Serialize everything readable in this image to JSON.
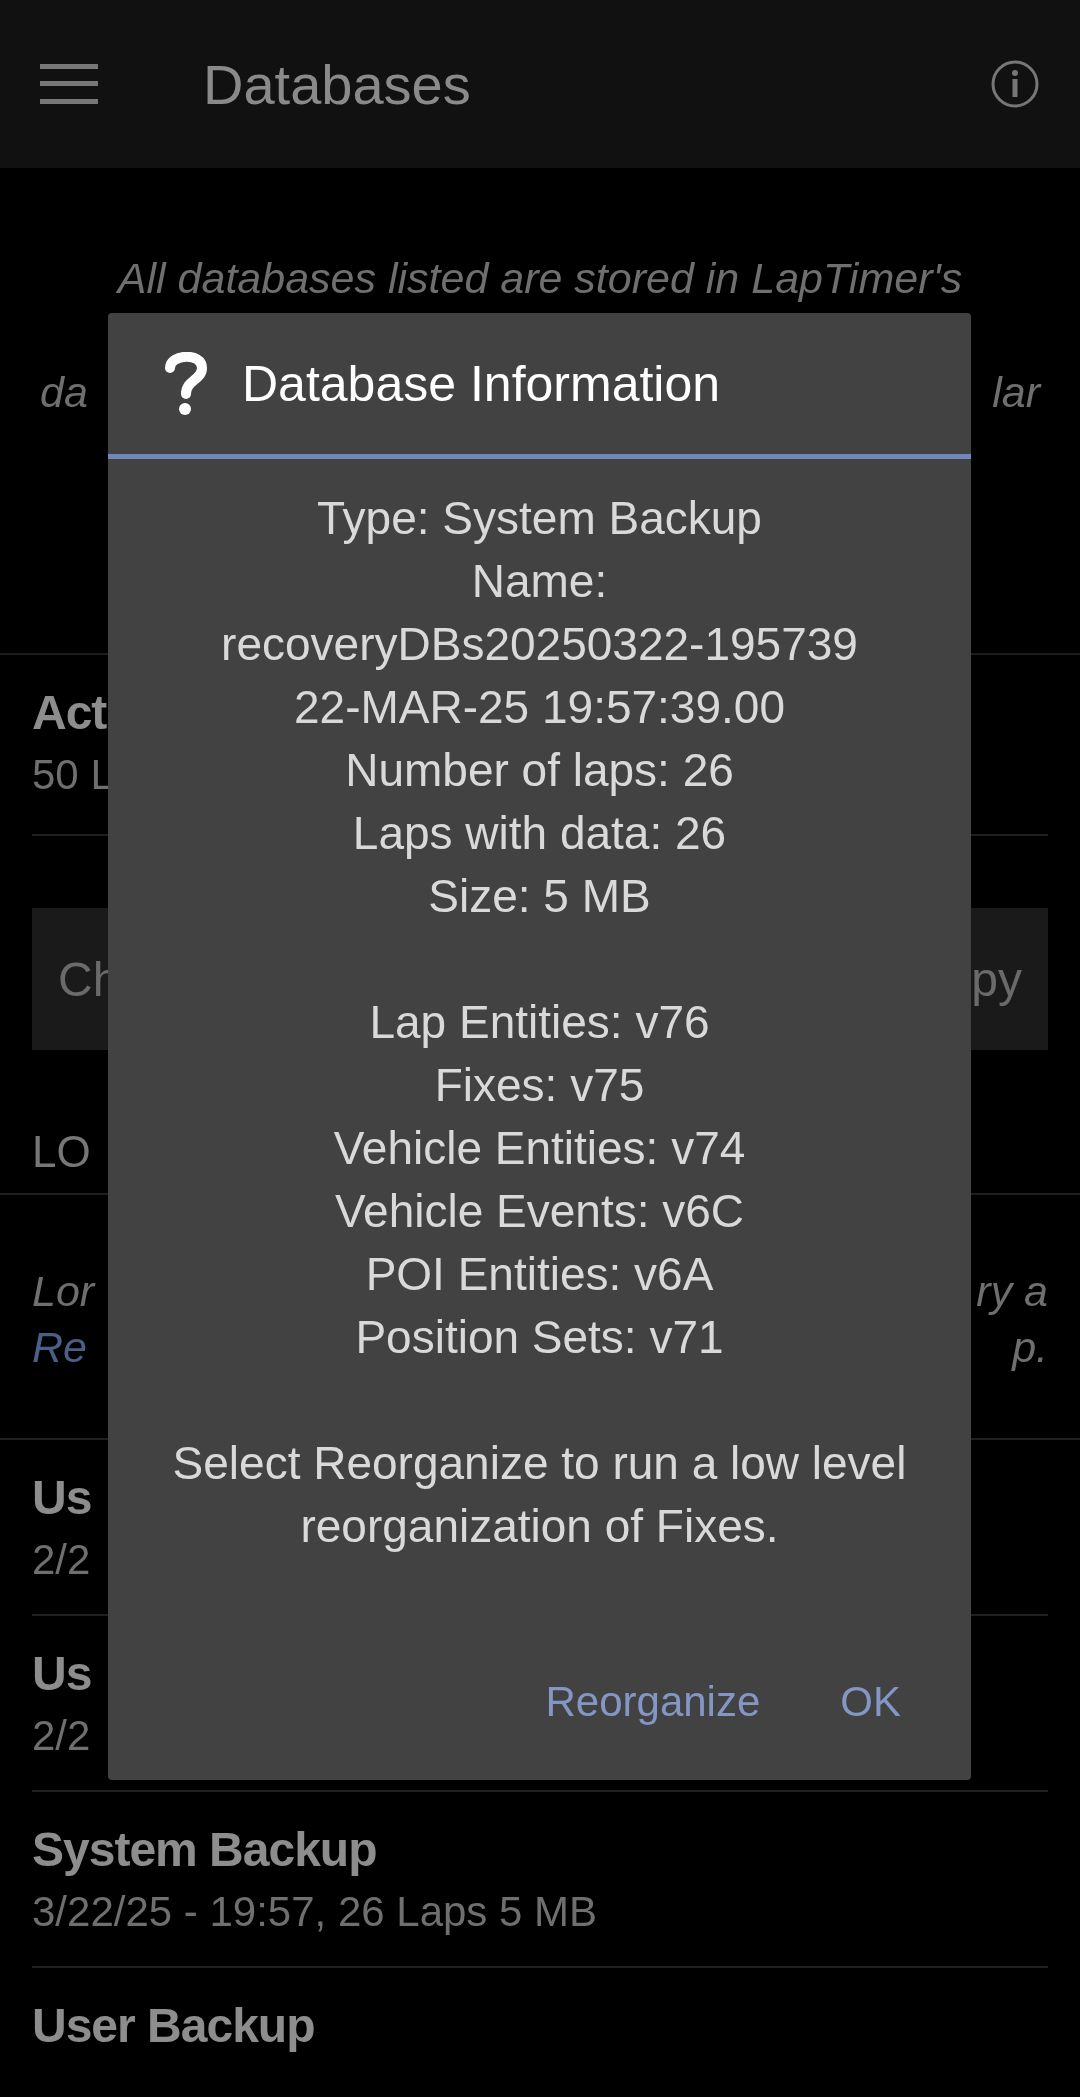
{
  "app_bar": {
    "title": "Databases"
  },
  "intro": {
    "lines": [
      [
        {
          "text": "All databases listed are stored in LapTimer's",
          "kind": "text"
        }
      ],
      [
        {
          "text": "da",
          "kind": "text"
        },
        {
          "text": "lar",
          "kind": "text"
        }
      ]
    ]
  },
  "active": {
    "title": "Act",
    "subtitle": "50 L"
  },
  "action_bar": {
    "left": "Ch",
    "right": "py"
  },
  "section_header": "LO",
  "note": {
    "lines": [
      [
        {
          "text": "Lor",
          "kind": "text"
        },
        {
          "text": "ry a",
          "kind": "text"
        }
      ],
      [
        {
          "text": "Re",
          "kind": "link"
        },
        {
          "text": "p.",
          "kind": "text"
        }
      ]
    ]
  },
  "databases": [
    {
      "title": "Us",
      "subtitle": "2/2"
    },
    {
      "title": "Us",
      "subtitle": "2/2"
    },
    {
      "title": "System Backup",
      "subtitle": "3/22/25 - 19:57, 26 Laps 5 MB"
    },
    {
      "title": "User Backup"
    }
  ],
  "dialog": {
    "title": "Database Information",
    "groups": [
      [
        "Type: System Backup",
        "Name:",
        "recoveryDBs20250322-195739",
        "22-MAR-25 19:57:39.00",
        "Number of laps: 26",
        "Laps with data: 26",
        "Size: 5 MB"
      ],
      [
        "Lap Entities: v76",
        "Fixes: v75",
        "Vehicle Entities: v74",
        "Vehicle Events: v6C",
        "POI Entities: v6A",
        "Position Sets: v71"
      ],
      [
        "Select Reorganize to run a low level reorganization of Fixes."
      ]
    ],
    "buttons": [
      "Reorganize",
      "OK"
    ]
  }
}
